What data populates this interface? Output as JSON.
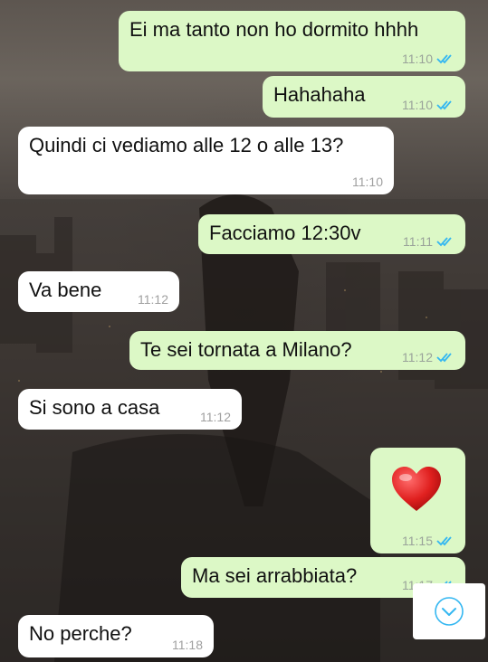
{
  "messages": [
    {
      "id": "m1",
      "dir": "out",
      "text": "Ei ma tanto non ho dormito hhhh",
      "time": "11:10",
      "read": true
    },
    {
      "id": "m2",
      "dir": "out",
      "text": "Hahahaha",
      "time": "11:10",
      "read": true
    },
    {
      "id": "m3",
      "dir": "in",
      "text": "Quindi ci vediamo alle 12 o alle 13?",
      "time": "11:10"
    },
    {
      "id": "m4",
      "dir": "out",
      "text": "Facciamo 12:30v",
      "time": "11:11",
      "read": true
    },
    {
      "id": "m5",
      "dir": "in",
      "text": "Va bene",
      "time": "11:12"
    },
    {
      "id": "m6",
      "dir": "out",
      "text": "Te sei tornata a Milano?",
      "time": "11:12",
      "read": true
    },
    {
      "id": "m7",
      "dir": "in",
      "text": "Si sono a casa",
      "time": "11:12"
    },
    {
      "id": "m8",
      "dir": "out",
      "emoji": "heart",
      "time": "11:15",
      "read": true
    },
    {
      "id": "m9",
      "dir": "out",
      "text": "Ma sei arrabbiata?",
      "time": "11:17",
      "read": true
    },
    {
      "id": "m10",
      "dir": "in",
      "text": "No perche?",
      "time": "11:18"
    }
  ],
  "colors": {
    "outgoing_bubble": "#dcf8c6",
    "incoming_bubble": "#ffffff",
    "read_ticks": "#34b7f1",
    "heart": "#e0201f"
  },
  "icons": {
    "read_receipt": "double-check-icon",
    "scroll_down": "chevron-down-icon"
  }
}
